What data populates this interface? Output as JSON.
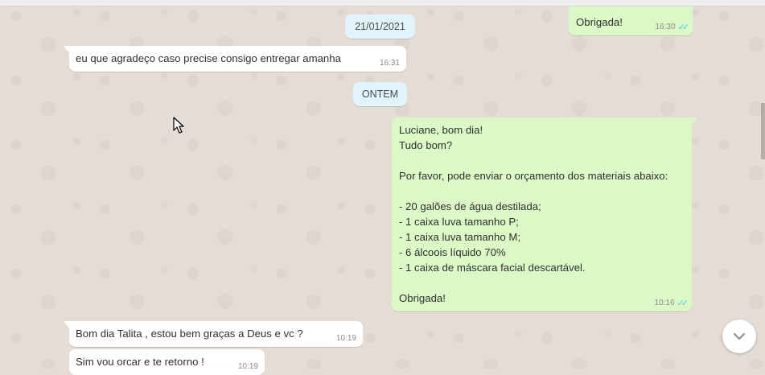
{
  "date_chip_1": "21/01/2021",
  "date_chip_2": "ONTEM",
  "messages": [
    {
      "dir": "out",
      "text": "Obrigada!",
      "time": "16:30"
    },
    {
      "dir": "in",
      "text": "eu que agradeço caso precise consigo entregar amanha",
      "time": "16:31"
    },
    {
      "dir": "out",
      "lines": [
        "Luciane, bom dia!",
        "Tudo bom?",
        "",
        "Por favor, pode enviar o orçamento dos materiais abaixo:",
        "",
        "- 20 galões de água destilada;",
        "- 1 caixa luva tamanho P;",
        "- 1 caixa luva tamanho M;",
        "- 6 álcoois líquido 70%",
        "- 1 caixa de máscara facial descartável.",
        "",
        "Obrigada!"
      ],
      "time": "10:16"
    },
    {
      "dir": "in",
      "text": "Bom dia Talita , estou bem graças a Deus e vc ?",
      "time": "10:19"
    },
    {
      "dir": "in",
      "text": "Sim vou orcar e te retorno !",
      "time": "10:19"
    }
  ],
  "colors": {
    "wallpaper": "#e5ddd5",
    "incoming": "#ffffff",
    "outgoing": "#dcf8c6",
    "date_chip": "#e1f3fb",
    "read_ticks": "#4fc3f7"
  },
  "icons": {
    "read_receipt": "double-check-icon",
    "scroll_down": "chevron-down-icon",
    "cursor": "mouse-pointer-icon"
  }
}
